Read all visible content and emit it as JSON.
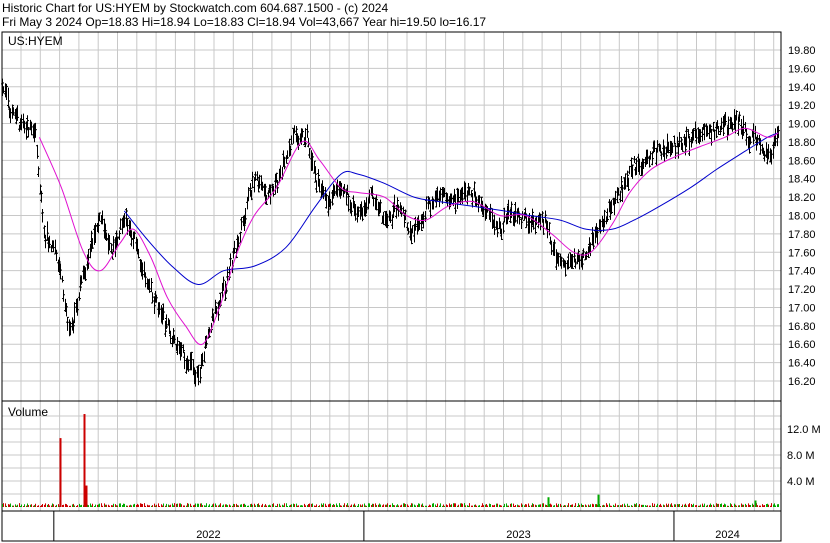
{
  "header": {
    "line1": "Historic Chart for US:HYEM by Stockwatch.com 604.687.1500 - (c) 2024",
    "line2": "Fri May  3 2024  Op=18.83  Hi=18.94  Lo=18.83  Cl=18.94  Vol=43,667  Year hi=19.50  lo=16.17"
  },
  "chart_data": [
    {
      "type": "line",
      "title": "US:HYEM",
      "subtype": "ohlc-bars with moving averages",
      "ylim": [
        16.0,
        19.9
      ],
      "y_ticks": [
        "19.80",
        "19.60",
        "19.40",
        "19.20",
        "19.00",
        "18.80",
        "18.60",
        "18.40",
        "18.20",
        "18.00",
        "17.80",
        "17.60",
        "17.40",
        "17.20",
        "17.00",
        "16.80",
        "16.60",
        "16.40",
        "16.20"
      ],
      "x_labels": [
        "2022",
        "2023",
        "2024"
      ],
      "grid": true,
      "colors": {
        "price": "#000000",
        "ma_short": "#e010d0",
        "ma_long": "#0000cc"
      },
      "price_key": [
        [
          "2021-11-01",
          19.4
        ],
        [
          "2021-11-15",
          19.05
        ],
        [
          "2021-12-01",
          18.95
        ],
        [
          "2021-12-10",
          18.9
        ],
        [
          "2021-12-20",
          17.85
        ],
        [
          "2022-01-05",
          17.55
        ],
        [
          "2022-01-20",
          16.7
        ],
        [
          "2022-02-01",
          17.2
        ],
        [
          "2022-02-15",
          17.75
        ],
        [
          "2022-02-25",
          17.95
        ],
        [
          "2022-03-10",
          17.6
        ],
        [
          "2022-03-25",
          17.95
        ],
        [
          "2022-04-05",
          17.75
        ],
        [
          "2022-04-20",
          17.3
        ],
        [
          "2022-05-05",
          16.95
        ],
        [
          "2022-05-20",
          16.7
        ],
        [
          "2022-06-05",
          16.45
        ],
        [
          "2022-06-20",
          16.25
        ],
        [
          "2022-07-05",
          16.85
        ],
        [
          "2022-07-20",
          17.2
        ],
        [
          "2022-08-10",
          17.85
        ],
        [
          "2022-08-25",
          18.45
        ],
        [
          "2022-09-10",
          18.2
        ],
        [
          "2022-09-25",
          18.45
        ],
        [
          "2022-10-10",
          18.9
        ],
        [
          "2022-10-25",
          18.85
        ],
        [
          "2022-11-05",
          18.4
        ],
        [
          "2022-11-20",
          18.15
        ],
        [
          "2022-12-05",
          18.3
        ],
        [
          "2022-12-25",
          18.0
        ],
        [
          "2023-01-10",
          18.25
        ],
        [
          "2023-01-25",
          17.95
        ],
        [
          "2023-02-10",
          18.1
        ],
        [
          "2023-02-25",
          17.8
        ],
        [
          "2023-03-15",
          18.05
        ],
        [
          "2023-04-01",
          18.25
        ],
        [
          "2023-04-20",
          18.15
        ],
        [
          "2023-05-10",
          18.25
        ],
        [
          "2023-05-25",
          18.05
        ],
        [
          "2023-06-10",
          17.85
        ],
        [
          "2023-06-25",
          18.05
        ],
        [
          "2023-07-15",
          17.95
        ],
        [
          "2023-08-01",
          17.95
        ],
        [
          "2023-08-15",
          17.55
        ],
        [
          "2023-09-01",
          17.45
        ],
        [
          "2023-09-15",
          17.55
        ],
        [
          "2023-10-05",
          17.9
        ],
        [
          "2023-10-25",
          18.2
        ],
        [
          "2023-11-15",
          18.55
        ],
        [
          "2023-12-05",
          18.65
        ],
        [
          "2023-12-25",
          18.75
        ],
        [
          "2024-01-15",
          18.8
        ],
        [
          "2024-02-05",
          18.9
        ],
        [
          "2024-02-25",
          18.95
        ],
        [
          "2024-03-15",
          19.05
        ],
        [
          "2024-03-28",
          18.85
        ],
        [
          "2024-04-10",
          18.8
        ],
        [
          "2024-04-22",
          18.65
        ],
        [
          "2024-05-03",
          18.94
        ]
      ],
      "ma_short": [
        [
          "2021-12-15",
          18.85
        ],
        [
          "2022-01-10",
          18.3
        ],
        [
          "2022-02-05",
          17.6
        ],
        [
          "2022-02-25",
          17.4
        ],
        [
          "2022-03-20",
          17.7
        ],
        [
          "2022-04-05",
          17.85
        ],
        [
          "2022-04-25",
          17.55
        ],
        [
          "2022-05-15",
          17.1
        ],
        [
          "2022-06-05",
          16.8
        ],
        [
          "2022-06-25",
          16.6
        ],
        [
          "2022-07-15",
          17.0
        ],
        [
          "2022-08-05",
          17.6
        ],
        [
          "2022-08-25",
          18.0
        ],
        [
          "2022-09-20",
          18.3
        ],
        [
          "2022-10-20",
          18.8
        ],
        [
          "2022-11-10",
          18.6
        ],
        [
          "2022-12-05",
          18.3
        ],
        [
          "2022-12-25",
          18.25
        ],
        [
          "2023-01-25",
          18.2
        ],
        [
          "2023-02-20",
          18.0
        ],
        [
          "2023-03-15",
          17.95
        ],
        [
          "2023-04-10",
          18.1
        ],
        [
          "2023-05-10",
          18.15
        ],
        [
          "2023-06-10",
          18.0
        ],
        [
          "2023-07-10",
          18.0
        ],
        [
          "2023-08-10",
          17.8
        ],
        [
          "2023-09-05",
          17.6
        ],
        [
          "2023-09-25",
          17.6
        ],
        [
          "2023-10-20",
          17.9
        ],
        [
          "2023-11-10",
          18.25
        ],
        [
          "2023-12-05",
          18.5
        ],
        [
          "2024-01-05",
          18.65
        ],
        [
          "2024-02-01",
          18.75
        ],
        [
          "2024-03-01",
          18.85
        ],
        [
          "2024-03-25",
          18.95
        ],
        [
          "2024-04-20",
          18.85
        ],
        [
          "2024-05-03",
          18.9
        ]
      ],
      "ma_long": [
        [
          "2022-03-25",
          18.05
        ],
        [
          "2022-04-20",
          17.75
        ],
        [
          "2022-05-20",
          17.45
        ],
        [
          "2022-06-20",
          17.25
        ],
        [
          "2022-07-20",
          17.4
        ],
        [
          "2022-08-25",
          17.45
        ],
        [
          "2022-10-01",
          17.65
        ],
        [
          "2022-11-05",
          18.1
        ],
        [
          "2022-12-05",
          18.45
        ],
        [
          "2022-12-25",
          18.45
        ],
        [
          "2023-01-25",
          18.35
        ],
        [
          "2023-03-01",
          18.2
        ],
        [
          "2023-04-01",
          18.15
        ],
        [
          "2023-05-10",
          18.1
        ],
        [
          "2023-06-15",
          18.05
        ],
        [
          "2023-07-15",
          18.0
        ],
        [
          "2023-08-20",
          17.95
        ],
        [
          "2023-09-20",
          17.85
        ],
        [
          "2023-10-20",
          17.85
        ],
        [
          "2023-11-15",
          17.95
        ],
        [
          "2023-12-15",
          18.1
        ],
        [
          "2024-01-20",
          18.3
        ],
        [
          "2024-02-20",
          18.5
        ],
        [
          "2024-03-25",
          18.7
        ],
        [
          "2024-04-20",
          18.85
        ],
        [
          "2024-05-03",
          18.9
        ]
      ]
    },
    {
      "type": "bar",
      "title": "Volume",
      "y_ticks": [
        "12.0 M",
        "8.0 M",
        "4.0 M"
      ],
      "ylim": [
        0,
        14.5
      ],
      "grid": true,
      "colors": {
        "up": "#00aa00",
        "down": "#cc0000"
      },
      "spikes": [
        [
          "2022-01-08",
          10.6,
          "down"
        ],
        [
          "2022-02-06",
          14.3,
          "down"
        ],
        [
          "2022-02-08",
          3.3,
          "down"
        ],
        [
          "2023-08-06",
          1.5,
          "up"
        ],
        [
          "2023-10-03",
          1.9,
          "up"
        ],
        [
          "2024-04-05",
          1.0,
          "up"
        ]
      ]
    }
  ]
}
